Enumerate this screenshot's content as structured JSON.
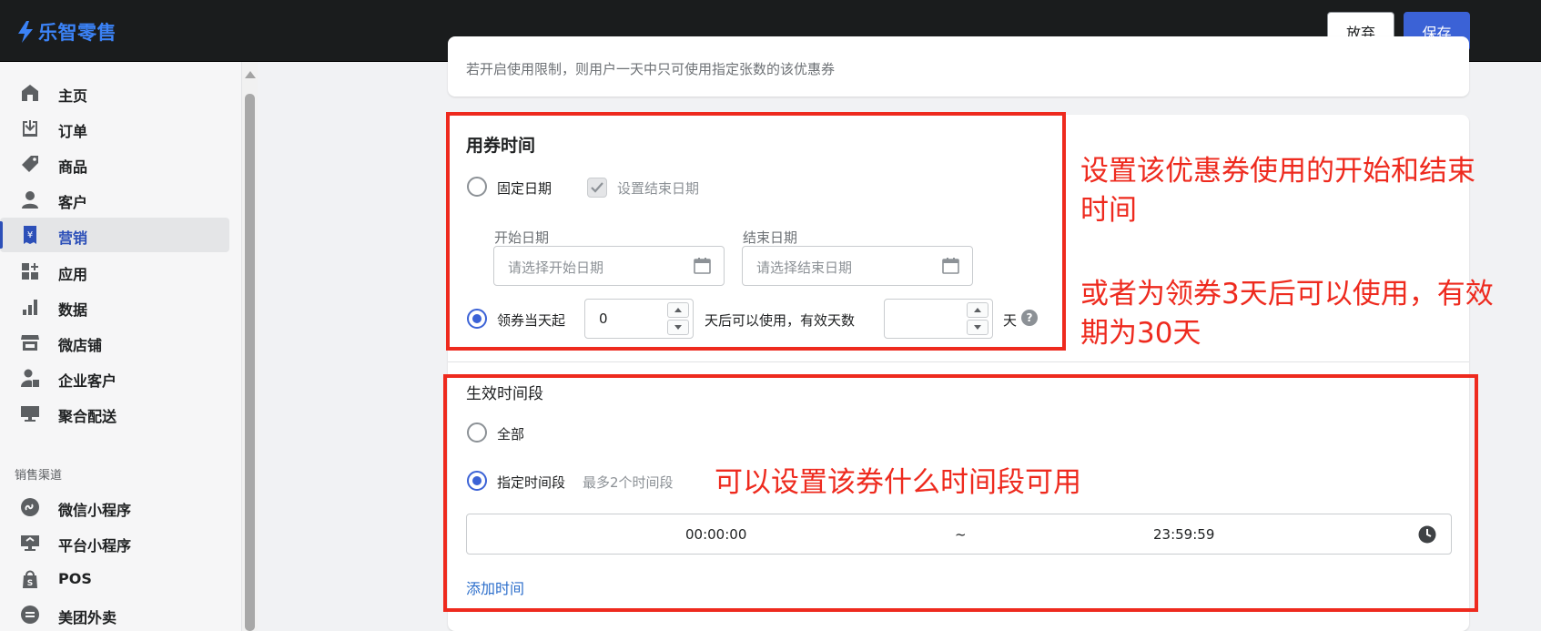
{
  "brand": {
    "name": "乐智零售",
    "color": "#3b82f6"
  },
  "header": {
    "discard_label": "放弃",
    "save_label": "保存"
  },
  "sidebar": {
    "items": [
      {
        "label": "主页",
        "icon": "home-icon"
      },
      {
        "label": "订单",
        "icon": "order-icon"
      },
      {
        "label": "商品",
        "icon": "tag-icon"
      },
      {
        "label": "客户",
        "icon": "person-icon"
      },
      {
        "label": "营销",
        "icon": "marketing-icon",
        "active": true
      },
      {
        "label": "应用",
        "icon": "apps-icon"
      },
      {
        "label": "数据",
        "icon": "bar-chart-icon"
      },
      {
        "label": "微店铺",
        "icon": "store-icon"
      },
      {
        "label": "企业客户",
        "icon": "enterprise-user-icon"
      },
      {
        "label": "聚合配送",
        "icon": "monitor-icon"
      }
    ],
    "section_title": "销售渠道",
    "channels": [
      {
        "label": "微信小程序",
        "icon": "wechat-miniprogram-icon"
      },
      {
        "label": "平台小程序",
        "icon": "platform-miniprogram-icon"
      },
      {
        "label": "POS",
        "icon": "pos-bag-icon"
      },
      {
        "label": "美团外卖",
        "icon": "meituan-icon"
      }
    ]
  },
  "top_card": {
    "hint": "若开启使用限制，则用户一天中只可使用指定张数的该优惠券"
  },
  "usage_time": {
    "title": "用券时间",
    "fixed_date_label": "固定日期",
    "set_end_date_label": "设置结束日期",
    "start_date_label": "开始日期",
    "start_date_placeholder": "请选择开始日期",
    "end_date_label": "结束日期",
    "end_date_placeholder": "请选择结束日期",
    "relative_label": "领券当天起",
    "relative_days_value": "0",
    "relative_mid_label": "天后可以使用，有效天数",
    "valid_days_value": "",
    "days_unit": "天",
    "help_mark": "?"
  },
  "effective_period": {
    "title": "生效时间段",
    "all_label": "全部",
    "specified_label": "指定时间段",
    "specified_hint": "最多2个时间段",
    "start_time": "00:00:00",
    "separator": "~",
    "end_time": "23:59:59",
    "add_time_link": "添加时间"
  },
  "annotations": {
    "note1_line1": "设置该优惠券使用的开始和结束",
    "note1_line2": "时间",
    "note2_line1": "或者为领券3天后可以使用，有效",
    "note2_line2": "期为30天",
    "note3": "可以设置该券什么时间段可用",
    "color": "#ee2a1e"
  }
}
